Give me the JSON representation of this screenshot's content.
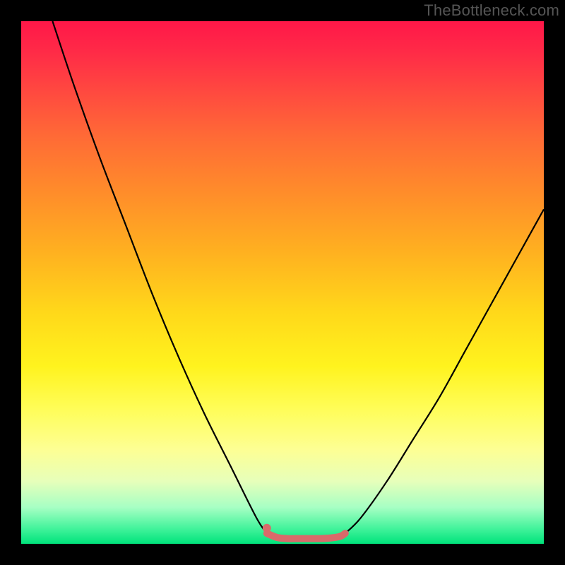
{
  "watermark": "TheBottleneck.com",
  "chart_data": {
    "type": "line",
    "title": "",
    "xlabel": "",
    "ylabel": "",
    "xlim": [
      0,
      100
    ],
    "ylim": [
      0,
      100
    ],
    "series": [
      {
        "name": "left-curve",
        "x": [
          6,
          10,
          15,
          20,
          25,
          30,
          35,
          40,
          45,
          47
        ],
        "values": [
          100,
          88,
          74,
          61,
          48,
          36,
          25,
          15,
          5,
          2
        ]
      },
      {
        "name": "right-curve",
        "x": [
          62,
          65,
          70,
          75,
          80,
          85,
          90,
          95,
          100
        ],
        "values": [
          2,
          5,
          12,
          20,
          28,
          37,
          46,
          55,
          64
        ]
      }
    ],
    "flat_segment": {
      "name": "bottom-marker",
      "x": [
        47,
        49,
        51,
        53,
        55,
        57,
        59,
        61,
        62
      ],
      "values": [
        2,
        1.2,
        1,
        1,
        1,
        1,
        1.1,
        1.4,
        2
      ]
    },
    "dot": {
      "x": 47,
      "y": 3
    }
  },
  "colors": {
    "curve": "#000000",
    "marker": "#d96a6a",
    "background_top": "#ff1748",
    "background_bottom": "#00e37b",
    "frame": "#000000",
    "watermark": "#555555"
  }
}
